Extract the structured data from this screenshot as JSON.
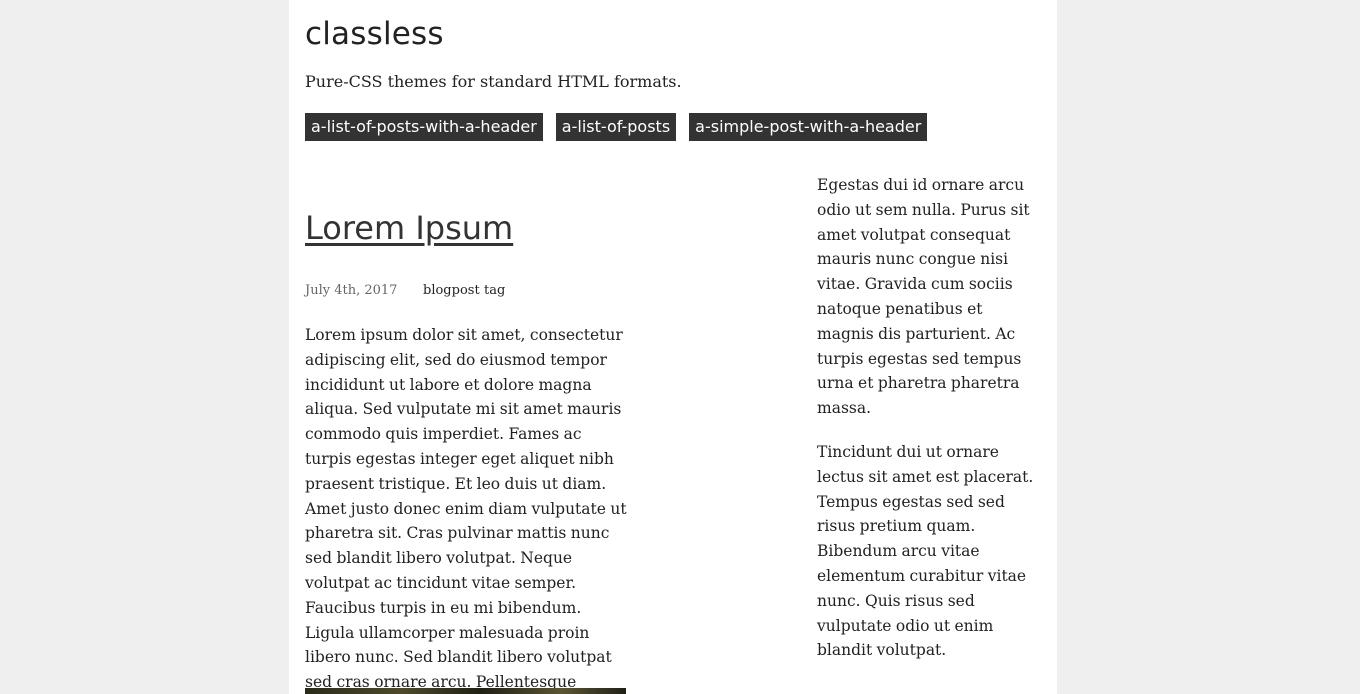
{
  "header": {
    "title": "classless",
    "description": "Pure-CSS themes for standard HTML formats."
  },
  "nav": {
    "items": [
      {
        "label": "a-list-of-posts-with-a-header"
      },
      {
        "label": "a-list-of-posts"
      },
      {
        "label": "a-simple-post-with-a-header"
      }
    ]
  },
  "post": {
    "title": "Lorem Ipsum",
    "date": "July 4th, 2017",
    "tags": [
      "blogpost",
      "tag"
    ],
    "body": "Lorem ipsum dolor sit amet, consectetur adipiscing elit, sed do eiusmod tempor incididunt ut labore et dolore magna aliqua. Sed vulputate mi sit amet mauris commodo quis imperdiet. Fames ac turpis egestas integer eget aliquet nibh praesent tristique. Et leo duis ut diam. Amet justo donec enim diam vulputate ut pharetra sit. Cras pulvinar mattis nunc sed blandit libero volutpat. Neque volutpat ac tincidunt vitae semper. Faucibus turpis in eu mi bibendum. Ligula ullamcorper malesuada proin libero nunc. Sed blandit libero volutpat sed cras ornare arcu. Pellentesque massa placerat duis ultricies lacus sed."
  },
  "aside": {
    "paragraphs": [
      "Egestas dui id ornare arcu odio ut sem nulla. Purus sit amet volutpat consequat mauris nunc congue nisi vitae. Gravida cum sociis natoque penatibus et magnis dis parturient. Ac turpis egestas sed tempus urna et pharetra pharetra massa.",
      "Tincidunt dui ut ornare lectus sit amet est placerat. Tempus egestas sed sed risus pretium quam. Bibendum arcu vitae elementum curabitur vitae nunc. Quis risus sed vulputate odio ut enim blandit volutpat."
    ]
  }
}
